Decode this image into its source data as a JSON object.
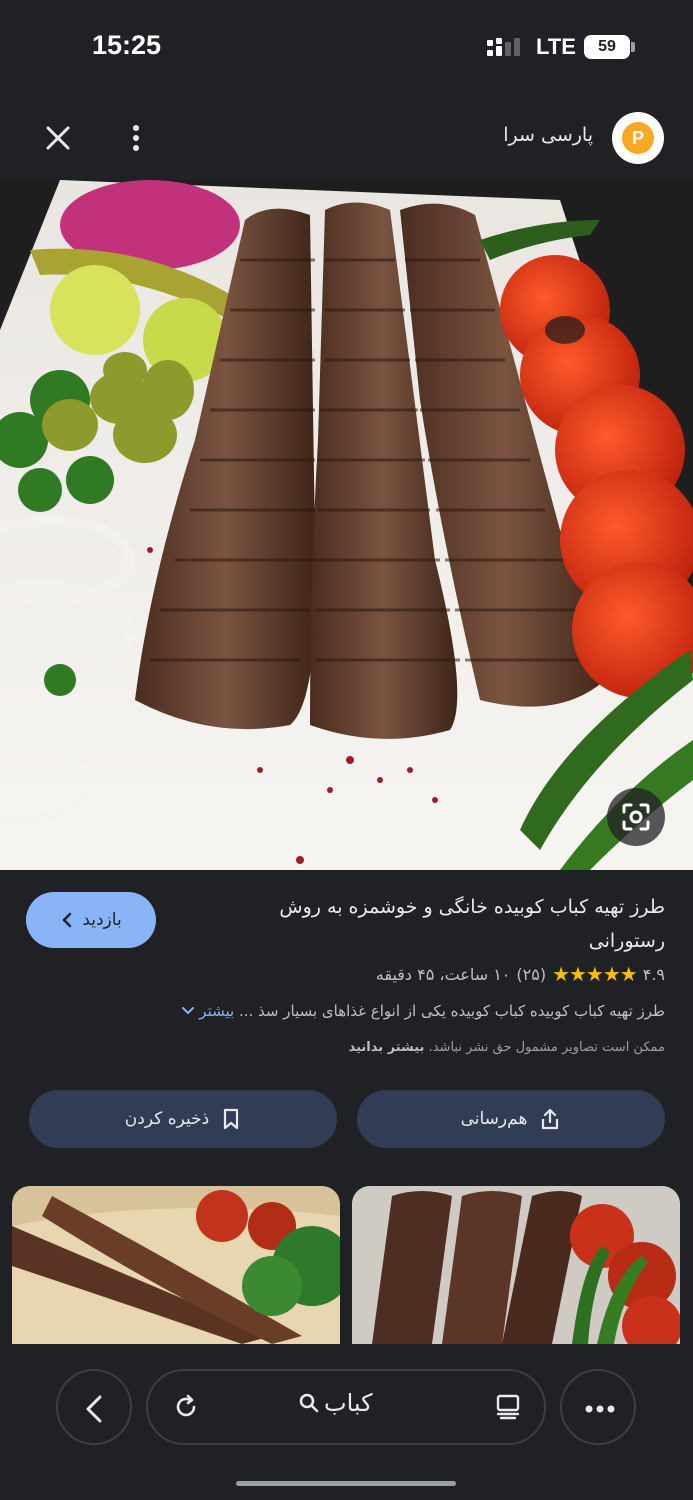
{
  "status": {
    "time": "15:25",
    "network": "LTE",
    "battery": "59"
  },
  "header": {
    "site_name": "پارسی سرا",
    "logo_letter": "P"
  },
  "result": {
    "title": "طرز تهیه کباب کوبیده خانگی و خوشمزه به روش رستورانی",
    "visit_label": "بازدید",
    "rating": "۴.۹",
    "stars": "★★★★★",
    "reviews": "(۲۵)",
    "duration": "۱۰ ساعت، ۴۵ دقیقه",
    "description": "طرز تهیه کباب کوبیده کباب کوبیده یکی از انواع غذاهای بسیار سذ ...",
    "more_label": "بیشتر",
    "copyright_text": "ممکن است تصاویر مشمول حق نشر نباشد.",
    "learn_more": "بیشتر بدانید",
    "share_label": "هم‌رسانی",
    "save_label": "ذخیره کردن"
  },
  "bottom": {
    "search_query": "کباب"
  },
  "colors": {
    "accent": "#8ab4f8",
    "background": "#202124",
    "button": "#303d55",
    "star": "#fbbc04"
  }
}
